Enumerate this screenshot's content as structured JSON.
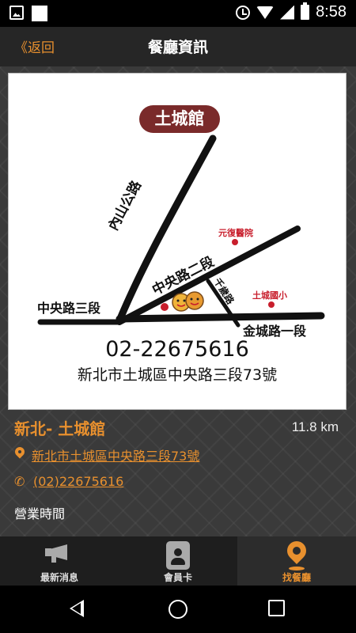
{
  "status_bar": {
    "time": "8:58"
  },
  "app_bar": {
    "back_label": "《返回",
    "title": "餐廳資訊"
  },
  "map": {
    "badge": "土城館",
    "roads": {
      "neishan": "內山公路",
      "zhongyang2": "中央路二段",
      "zhongyang3": "中央路三段",
      "qiansheng": "千歲路",
      "jincheng1": "金城路一段"
    },
    "landmarks": {
      "hospital": "元復醫院",
      "school": "土城國小"
    },
    "phone": "02-22675616",
    "address": "新北市土城區中央路三段73號"
  },
  "restaurant": {
    "name": "新北- 土城館",
    "distance": "11.8 km",
    "address": "新北市土城區中央路三段73號",
    "phone": "(02)22675616",
    "hours_label": "營業時間"
  },
  "tabs": [
    {
      "label": "最新消息",
      "icon": "megaphone-icon",
      "active": false
    },
    {
      "label": "會員卡",
      "icon": "member-card-icon",
      "active": false
    },
    {
      "label": "找餐廳",
      "icon": "location-pin-icon",
      "active": true
    }
  ],
  "colors": {
    "accent": "#e8902e",
    "badge": "#7a2a2a",
    "landmark": "#c81e2c"
  }
}
